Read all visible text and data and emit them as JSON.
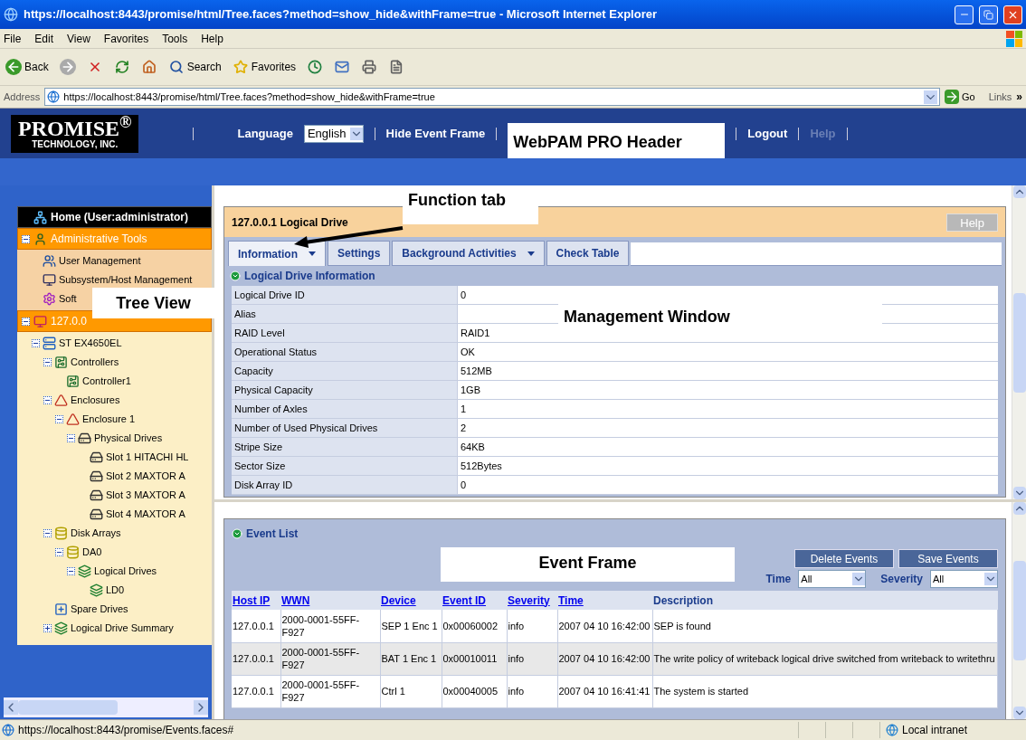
{
  "window": {
    "title": "https://localhost:8443/promise/html/Tree.faces?method=show_hide&withFrame=true - Microsoft Internet Explorer"
  },
  "menu": [
    "File",
    "Edit",
    "View",
    "Favorites",
    "Tools",
    "Help"
  ],
  "toolbar": [
    {
      "kind": "back",
      "label": "Back"
    },
    {
      "kind": "forward"
    },
    {
      "kind": "stop"
    },
    {
      "kind": "refresh"
    },
    {
      "kind": "home"
    },
    {
      "kind": "search",
      "label": "Search"
    },
    {
      "kind": "favorites",
      "label": "Favorites"
    },
    {
      "kind": "history"
    },
    {
      "kind": "mail"
    },
    {
      "kind": "print"
    },
    {
      "kind": "edit"
    }
  ],
  "address": {
    "label": "Address",
    "value": "https://localhost:8443/promise/html/Tree.faces?method=show_hide&withFrame=true",
    "go": "Go",
    "links": "Links",
    "more": "»"
  },
  "header": {
    "logo": "PROMISE$^{®}$",
    "tagline": "TECHNOLOGY, INC.",
    "language_label": "Language",
    "language_value": "English",
    "links": [
      {
        "label": "Hide Event Frame",
        "disabled": false
      },
      {
        "label": "Logout",
        "disabled": false
      },
      {
        "label": "Help",
        "disabled": true
      }
    ],
    "callout": "WebPAM PRO Header"
  },
  "tree": {
    "callout": "Tree View",
    "nodes": [
      {
        "kind": "home",
        "label": "Home (User:administrator)"
      },
      {
        "kind": "admin",
        "label": "Administrative Tools",
        "expanded": true,
        "children": [
          {
            "kind": "users",
            "label": "User Management"
          },
          {
            "kind": "host-mgmt",
            "label": "Subsystem/Host Management"
          },
          {
            "kind": "software",
            "label": "Soft"
          }
        ]
      },
      {
        "kind": "host",
        "label": "127.0.0",
        "expanded": true,
        "children": [
          {
            "kind": "subsystem",
            "label": "ST EX4650EL",
            "expanded": true,
            "children": [
              {
                "kind": "controller",
                "label": "Controllers",
                "expanded": true,
                "children": [
                  {
                    "kind": "controller",
                    "label": "Controller1"
                  }
                ]
              },
              {
                "kind": "enclosure",
                "label": "Enclosures",
                "expanded": true,
                "children": [
                  {
                    "kind": "enclosure",
                    "label": "Enclosure 1",
                    "expanded": true,
                    "children": [
                      {
                        "kind": "drives",
                        "label": "Physical Drives",
                        "expanded": true,
                        "children": [
                          {
                            "kind": "drive",
                            "label": "Slot 1 HITACHI HL"
                          },
                          {
                            "kind": "drive",
                            "label": "Slot 2 MAXTOR A"
                          },
                          {
                            "kind": "drive",
                            "label": "Slot 3 MAXTOR A"
                          },
                          {
                            "kind": "drive",
                            "label": "Slot 4 MAXTOR A"
                          }
                        ]
                      }
                    ]
                  }
                ]
              },
              {
                "kind": "array",
                "label": "Disk Arrays",
                "expanded": true,
                "children": [
                  {
                    "kind": "array",
                    "label": "DA0",
                    "expanded": true,
                    "children": [
                      {
                        "kind": "logical",
                        "label": "Logical Drives",
                        "expanded": true,
                        "children": [
                          {
                            "kind": "logical",
                            "label": "LD0"
                          }
                        ]
                      }
                    ]
                  }
                ]
              },
              {
                "kind": "spare",
                "label": "Spare Drives"
              },
              {
                "kind": "logical",
                "label": "Logical Drive Summary",
                "expanded": false
              }
            ]
          }
        ]
      }
    ]
  },
  "management": {
    "title": "127.0.0.1 Logical Drive",
    "help": "Help",
    "callouts": [
      "Function tab",
      "Management Window"
    ],
    "tabs": [
      {
        "label": "Information",
        "selected": true,
        "dropdown": true
      },
      {
        "label": "Settings",
        "selected": false,
        "dropdown": false
      },
      {
        "label": "Background Activities",
        "selected": false,
        "dropdown": true
      },
      {
        "label": "Check Table",
        "selected": false,
        "dropdown": false
      }
    ],
    "section": "Logical Drive Information",
    "rows": [
      {
        "label": "Logical Drive ID",
        "value": "0"
      },
      {
        "label": "Alias",
        "value": ""
      },
      {
        "label": "RAID Level",
        "value": "RAID1"
      },
      {
        "label": "Operational Status",
        "value": "OK"
      },
      {
        "label": "Capacity",
        "value": "512MB"
      },
      {
        "label": "Physical Capacity",
        "value": "1GB"
      },
      {
        "label": "Number of Axles",
        "value": "1"
      },
      {
        "label": "Number of Used Physical Drives",
        "value": "2"
      },
      {
        "label": "Stripe Size",
        "value": "64KB"
      },
      {
        "label": "Sector Size",
        "value": "512Bytes"
      },
      {
        "label": "Disk Array ID",
        "value": "0"
      }
    ]
  },
  "events": {
    "section": "Event List",
    "callout": "Event Frame",
    "buttons": [
      "Delete Events",
      "Save Events"
    ],
    "filters": [
      {
        "label": "Time",
        "value": "All"
      },
      {
        "label": "Severity",
        "value": "All"
      }
    ],
    "columns": [
      "Host IP",
      "WWN",
      "Device",
      "Event ID",
      "Severity",
      "Time",
      "Description"
    ],
    "rows": [
      [
        "127.0.0.1",
        "2000-0001-55FF-F927",
        "SEP 1 Enc 1",
        "0x00060002",
        "info",
        "2007 04 10 16:42:00",
        "SEP is found"
      ],
      [
        "127.0.0.1",
        "2000-0001-55FF-F927",
        "BAT 1 Enc 1",
        "0x00010011",
        "info",
        "2007 04 10 16:42:00",
        "The write policy of writeback logical drive switched from writeback to writethru"
      ],
      [
        "127.0.0.1",
        "2000-0001-55FF-F927",
        "Ctrl 1",
        "0x00040005",
        "info",
        "2007 04 10 16:41:41",
        "The system is started"
      ]
    ]
  },
  "status_bar": {
    "url": "https://localhost:8443/promise/Events.faces#",
    "zone": "Local intranet"
  }
}
